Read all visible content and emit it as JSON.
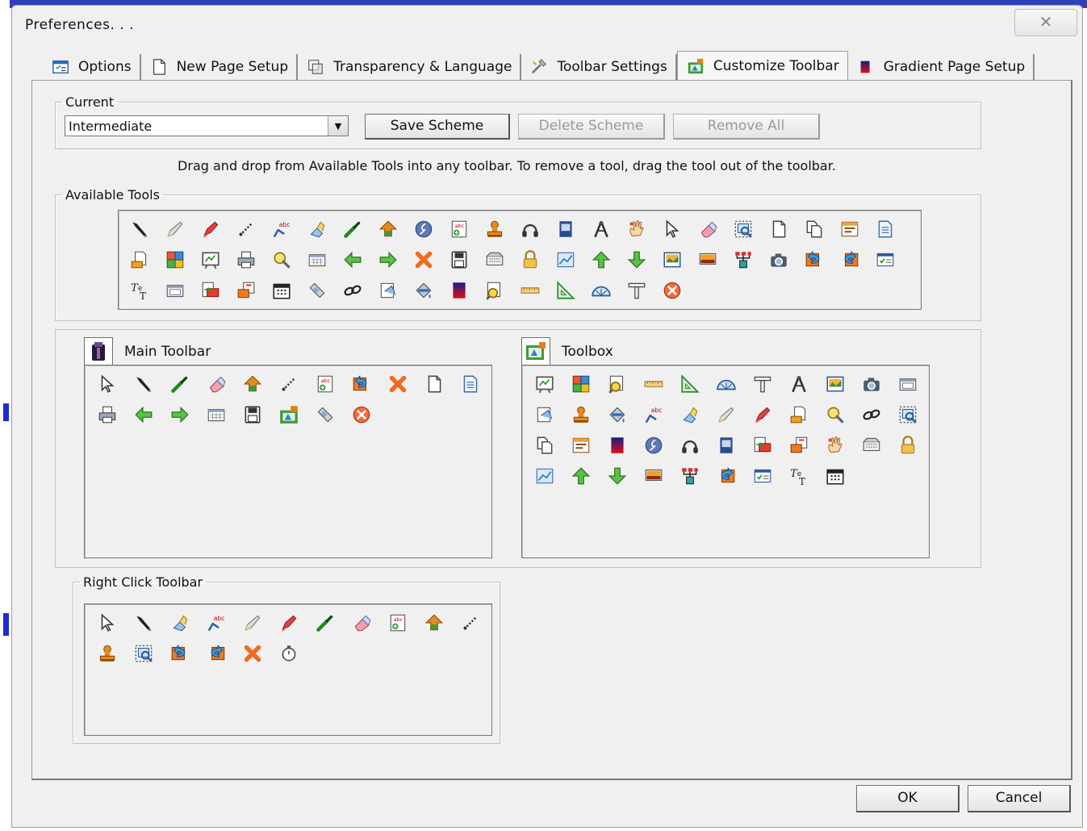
{
  "window": {
    "title": "Preferences. . .",
    "close_glyph": "✕"
  },
  "tabs": [
    {
      "label": "Options",
      "icon": "options-icon"
    },
    {
      "label": "New Page Setup",
      "icon": "page-icon"
    },
    {
      "label": "Transparency & Language",
      "icon": "transparency-icon"
    },
    {
      "label": "Toolbar Settings",
      "icon": "toolbar-settings-icon"
    },
    {
      "label": "Customize Toolbar",
      "icon": "customize-toolbar-icon",
      "active": true
    },
    {
      "label": "Gradient Page Setup",
      "icon": "gradient-icon"
    }
  ],
  "current": {
    "legend": "Current",
    "scheme_value": "Intermediate",
    "dropdown_glyph": "▼",
    "save_label": "Save Scheme",
    "delete_label": "Delete Scheme",
    "remove_label": "Remove All",
    "hint": "Drag and drop from Available Tools into any toolbar.  To remove a tool, drag the tool out of the toolbar."
  },
  "available": {
    "legend": "Available Tools",
    "tools": [
      "pen",
      "pencil",
      "highlighter",
      "line",
      "spell-check",
      "eraser-brush",
      "marker",
      "arrow-shape",
      "flash",
      "spell-page",
      "stamp",
      "headphones",
      "window",
      "compass",
      "hand",
      "pointer",
      "eraser",
      "screen-capture",
      "page",
      "copy",
      "calendar",
      "document",
      "export",
      "clipboard",
      "whiteboard",
      "print",
      "magnifier",
      "keyboard",
      "back",
      "forward",
      "delete",
      "save",
      "keyboard2",
      "lock",
      "chart",
      "up",
      "down",
      "image",
      "slideshow",
      "network",
      "camera",
      "undo",
      "redo",
      "checklist",
      "text",
      "window2",
      "import",
      "export2",
      "calendar2",
      "telephone",
      "link",
      "undo2",
      "fill",
      "gradient",
      "magnifier2",
      "ruler",
      "triangle",
      "protractor",
      "t-square",
      "close"
    ]
  },
  "main_toolbar": {
    "label": "Main Toolbar",
    "tools": [
      "pointer",
      "pen",
      "marker",
      "eraser",
      "arrow-shape",
      "line",
      "spell-page",
      "undo",
      "delete",
      "page",
      "document",
      "print",
      "back",
      "forward",
      "keyboard",
      "save",
      "toolbox",
      "telephone",
      "close"
    ]
  },
  "toolbox": {
    "label": "Toolbox",
    "tools": [
      "whiteboard",
      "clipboard",
      "magnifier2",
      "ruler",
      "triangle",
      "protractor",
      "t-square",
      "compass",
      "image",
      "camera",
      "window2",
      "undo2",
      "stamp",
      "fill",
      "spell-check",
      "eraser-brush",
      "pencil",
      "highlighter",
      "export",
      "magnifier",
      "link",
      "screen-capture",
      "copy",
      "calendar",
      "gradient",
      "flash",
      "headphones",
      "window",
      "import",
      "export2",
      "hand",
      "keyboard2",
      "lock",
      "chart",
      "up",
      "down",
      "slideshow",
      "network",
      "redo",
      "checklist",
      "text",
      "calendar2"
    ]
  },
  "right_click": {
    "legend": "Right Click Toolbar",
    "tools": [
      "pointer",
      "pen",
      "eraser-brush",
      "spell-check",
      "pencil",
      "highlighter",
      "marker",
      "eraser",
      "spell-page",
      "arrow-shape",
      "line",
      "stamp",
      "screen-capture",
      "undo",
      "redo",
      "delete",
      "timer"
    ]
  },
  "dialog_buttons": {
    "ok": "OK",
    "cancel": "Cancel"
  }
}
